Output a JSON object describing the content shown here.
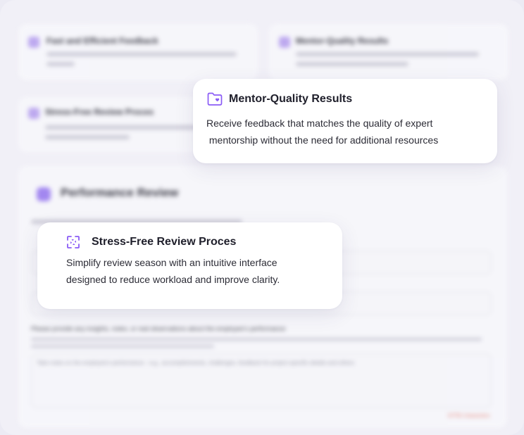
{
  "background": {
    "feature_cards": [
      {
        "title": "Fast and Efficient Feedback"
      },
      {
        "title": "Mentor-Quality Results"
      },
      {
        "title": "Stress-Free Review Proces"
      }
    ],
    "form": {
      "heading": "Performance Review",
      "textarea_label": "Please provide any insights, notes, or real observations about the employee's performance",
      "textarea_placeholder": "Take notes on the employee's performance - e.g., accomplishments, challenges, feedback for project specific details and others",
      "counter": "0/750 characters"
    }
  },
  "cards": {
    "mentor": {
      "icon": "folder-heart-icon",
      "title": "Mentor-Quality Results",
      "desc_line1": "Receive feedback that matches the quality of expert",
      "desc_line2": " mentorship without the need for additional resources"
    },
    "stress": {
      "icon": "refresh-arrows-icon",
      "title": "Stress-Free Review Proces",
      "desc_line1": "Simplify review season with an intuitive interface",
      "desc_line2": "designed to reduce workload and improve clarity."
    }
  },
  "colors": {
    "accent": "#8b5cf6",
    "background": "#f1f0f7",
    "card": "#ffffff",
    "text": "#1f1f2b"
  }
}
